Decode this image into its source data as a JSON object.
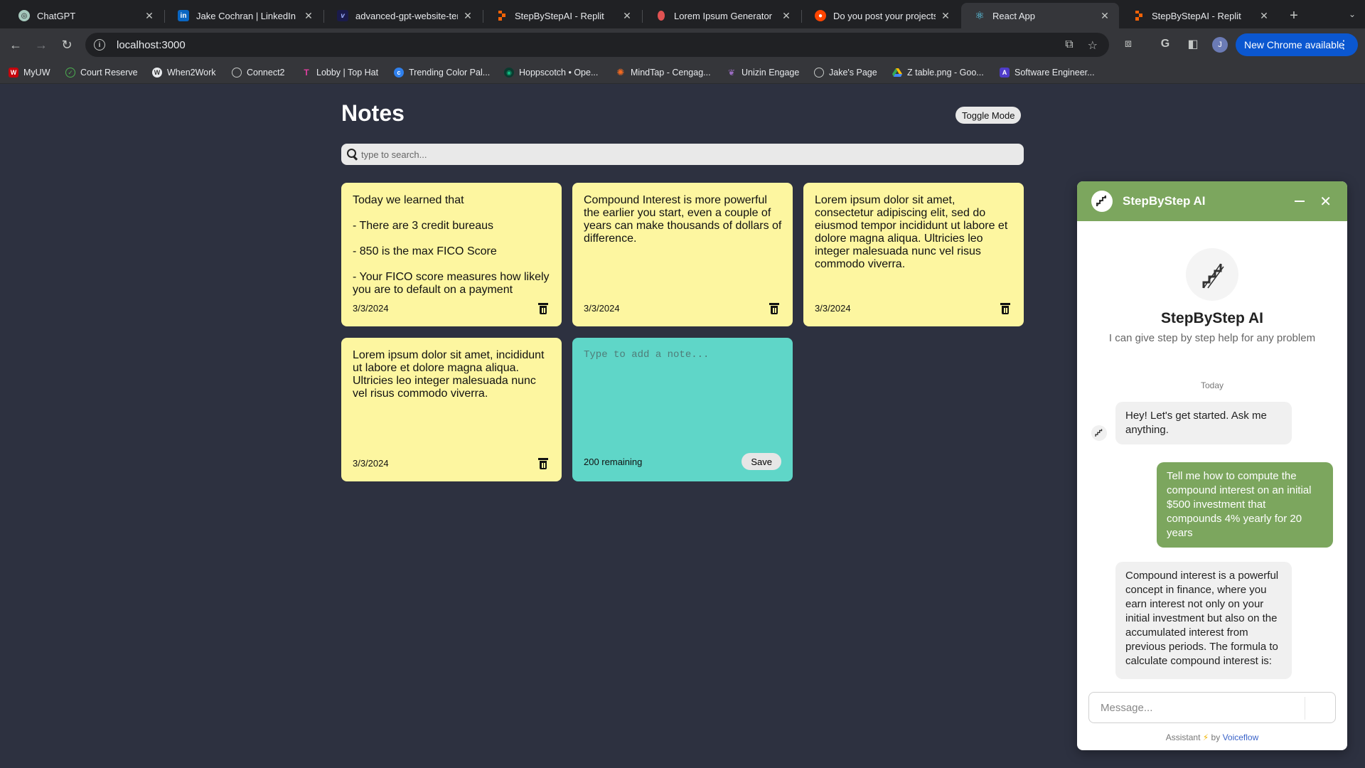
{
  "browser": {
    "tabs": [
      {
        "title": "ChatGPT",
        "icon": "chatgpt-icon"
      },
      {
        "title": "Jake Cochran | LinkedIn",
        "icon": "linkedin-icon"
      },
      {
        "title": "advanced-gpt-website-ten",
        "icon": "v-icon"
      },
      {
        "title": "StepByStepAI - Replit",
        "icon": "replit-icon"
      },
      {
        "title": "Lorem Ipsum Generator",
        "icon": "lorem-icon"
      },
      {
        "title": "Do you post your projects o",
        "icon": "reddit-icon"
      },
      {
        "title": "React App",
        "icon": "react-icon"
      },
      {
        "title": "StepByStepAI - Replit",
        "icon": "replit-icon"
      }
    ],
    "active_tab_index": 6,
    "url": "localhost:3000",
    "update_label": "New Chrome available",
    "profile_initial": "J",
    "bookmarks": [
      "MyUW",
      "Court Reserve",
      "When2Work",
      "Connect2",
      "Lobby | Top Hat",
      "Trending Color Pal...",
      "Hoppscotch • Ope...",
      "MindTap - Cengag...",
      "Unizin Engage",
      "Jake's Page",
      "Z table.png - Goo...",
      "Software Engineer..."
    ]
  },
  "notes_app": {
    "title": "Notes",
    "toggle_label": "Toggle Mode",
    "search_placeholder": "type to search...",
    "notes": [
      {
        "text": "Today we learned that\n\n- There are 3 credit bureaus\n\n- 850 is the max FICO Score\n\n- Your FICO score measures how likely you are to default on a payment",
        "date": "3/3/2024"
      },
      {
        "text": "Compound Interest is more powerful the earlier you start, even a couple of years can make thousands of dollars of difference.",
        "date": "3/3/2024"
      },
      {
        "text": "Lorem ipsum dolor sit amet, consectetur adipiscing elit, sed do eiusmod tempor incididunt ut labore et dolore magna aliqua. Ultricies leo integer malesuada nunc vel risus commodo viverra.",
        "date": "3/3/2024"
      },
      {
        "text": "Lorem ipsum dolor sit amet, incididunt ut labore et dolore magna aliqua. Ultricies leo integer malesuada nunc vel risus commodo viverra.",
        "date": "3/3/2024"
      }
    ],
    "new_note": {
      "placeholder": "Type to add a note...",
      "remaining": "200 remaining",
      "save_label": "Save"
    },
    "colors": {
      "note": "#fdf6a0",
      "new_note": "#5fd6c8",
      "background": "#2d3140"
    }
  },
  "chat_widget": {
    "header_title": "StepByStep AI",
    "bot_name": "StepByStep AI",
    "bot_description": "I can give step by step help for any problem",
    "day_label": "Today",
    "messages": [
      {
        "from": "bot",
        "text": "Hey! Let's get started. Ask me anything."
      },
      {
        "from": "user",
        "text": "Tell me how to compute the compound interest on an initial $500 investment that compounds 4% yearly for 20 years"
      },
      {
        "from": "bot",
        "text": "Compound interest is a powerful concept in finance, where you earn interest not only on your initial investment but also on the accumulated interest from previous periods. The formula to calculate compound interest is:"
      }
    ],
    "input_placeholder": "Message...",
    "footer_prefix": "Assistant",
    "footer_by": "by",
    "footer_brand": "Voiceflow",
    "accent_color": "#7ca65e"
  }
}
